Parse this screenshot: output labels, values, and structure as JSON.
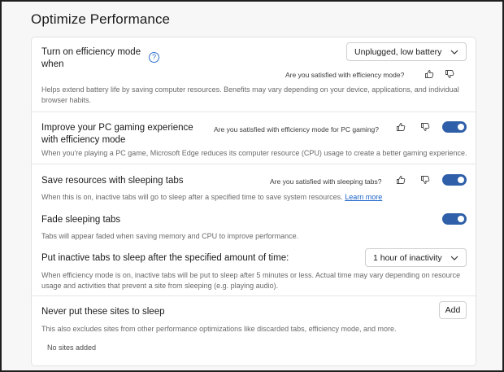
{
  "page_title": "Optimize Performance",
  "efficiency_mode": {
    "title": "Turn on efficiency mode when",
    "help_icon": "question-circle-icon",
    "dropdown_value": "Unplugged, low battery",
    "feedback_question": "Are you satisfied with efficiency mode?",
    "description": "Helps extend battery life by saving computer resources. Benefits may vary depending on your device, applications, and individual browser habits."
  },
  "gaming": {
    "title": "Improve your PC gaming experience with efficiency mode",
    "feedback_question": "Are you satisfied with efficiency mode for PC gaming?",
    "description": "When you're playing a PC game, Microsoft Edge reduces its computer resource (CPU) usage to create a better gaming experience.",
    "toggle_on": true
  },
  "sleeping_tabs": {
    "title": "Save resources with sleeping tabs",
    "feedback_question": "Are you satisfied with sleeping tabs?",
    "description": "When this is on, inactive tabs will go to sleep after a specified time to save system resources.",
    "learn_more": "Learn more",
    "toggle_on": true
  },
  "fade_tabs": {
    "title": "Fade sleeping tabs",
    "description": "Tabs will appear faded when saving memory and CPU to improve performance.",
    "toggle_on": true
  },
  "inactive_tabs": {
    "title": "Put inactive tabs to sleep after the specified amount of time:",
    "dropdown_value": "1 hour of inactivity",
    "description": "When efficiency mode is on, inactive tabs will be put to sleep after 5 minutes or less. Actual time may vary depending on resource usage and activities that prevent a site from sleeping (e.g. playing audio)."
  },
  "never_sleep": {
    "title": "Never put these sites to sleep",
    "add_label": "Add",
    "description": "This also excludes sites from other performance optimizations like discarded tabs, efficiency mode, and more.",
    "empty_text": "No sites added"
  },
  "colors": {
    "toggle_on": "#2e5fa8",
    "link": "#1a62c8",
    "help_icon": "#2d6fd1"
  }
}
